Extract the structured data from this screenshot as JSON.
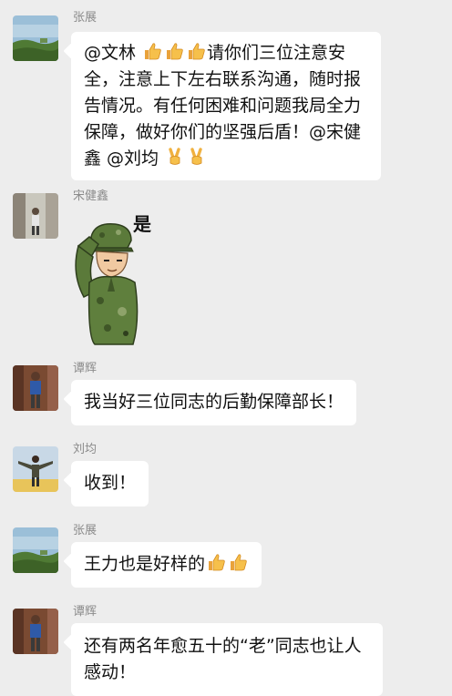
{
  "messages": [
    {
      "sender": "张展",
      "avatar_icon": "landscape-avatar-icon",
      "parts": [
        {
          "t": "text",
          "v": "@文林 "
        },
        {
          "t": "emoji",
          "v": "thumbs-up-icon"
        },
        {
          "t": "emoji",
          "v": "thumbs-up-icon"
        },
        {
          "t": "emoji",
          "v": "thumbs-up-icon"
        },
        {
          "t": "text",
          "v": "请你们三位注意安全，注意上下左右联系沟通，随时报告情况。有任何困难和问题我局全力保障，做好你们的坚强后盾！@宋健鑫 @刘均 "
        },
        {
          "t": "emoji",
          "v": "victory-hand-icon"
        },
        {
          "t": "emoji",
          "v": "victory-hand-icon"
        }
      ]
    },
    {
      "sender": "宋健鑫",
      "avatar_icon": "person-outdoors-avatar-icon",
      "sticker_icon": "saluting-soldier-sticker-icon",
      "sticker_text": "是"
    },
    {
      "sender": "谭辉",
      "avatar_icon": "person-standing-avatar-icon",
      "text": "我当好三位同志的后勤保障部长！"
    },
    {
      "sender": "刘均",
      "avatar_icon": "person-arms-open-avatar-icon",
      "text": "收到！"
    },
    {
      "sender": "张展",
      "avatar_icon": "landscape-avatar-icon",
      "parts": [
        {
          "t": "text",
          "v": "王力也是好样的"
        },
        {
          "t": "emoji",
          "v": "thumbs-up-icon"
        },
        {
          "t": "emoji",
          "v": "thumbs-up-icon"
        }
      ]
    },
    {
      "sender": "谭辉",
      "avatar_icon": "person-standing-avatar-icon",
      "text": "还有两名年愈五十的“老”同志也让人感动！"
    }
  ]
}
